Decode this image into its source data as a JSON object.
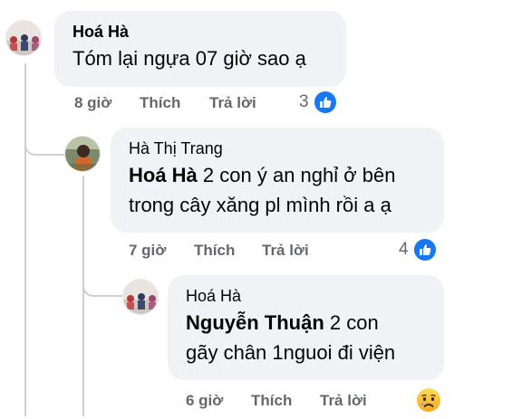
{
  "colors": {
    "bubble": "#f0f2f5",
    "accent": "#1877f2",
    "meta": "#65676b",
    "line": "#ced0d4"
  },
  "comments": [
    {
      "author": "Hoá Hà",
      "text": "Tóm lại ngựa 07 giờ sao ạ",
      "time": "8 giờ",
      "like_label": "Thích",
      "reply_label": "Trả lời",
      "reaction_count": "3",
      "reaction_icon": "like-icon"
    },
    {
      "author": "Hà Thị Trang",
      "mention": "Hoá Hà",
      "text_line1": "2 con ý an nghỉ ở bên",
      "text_line2": "trong cây xăng pl mình rồi a ạ",
      "time": "7 giờ",
      "like_label": "Thích",
      "reply_label": "Trả lời",
      "reaction_count": "4",
      "reaction_icon": "like-icon"
    },
    {
      "author": "Hoá Hà",
      "mention": "Nguyễn Thuận",
      "text_line1": "2 con",
      "text_line2": "gãy chân 1nguoi đi viện",
      "time": "6 giờ",
      "like_label": "Thích",
      "reply_label": "Trả lời",
      "reaction_icon": "sad-emoji-icon"
    }
  ]
}
